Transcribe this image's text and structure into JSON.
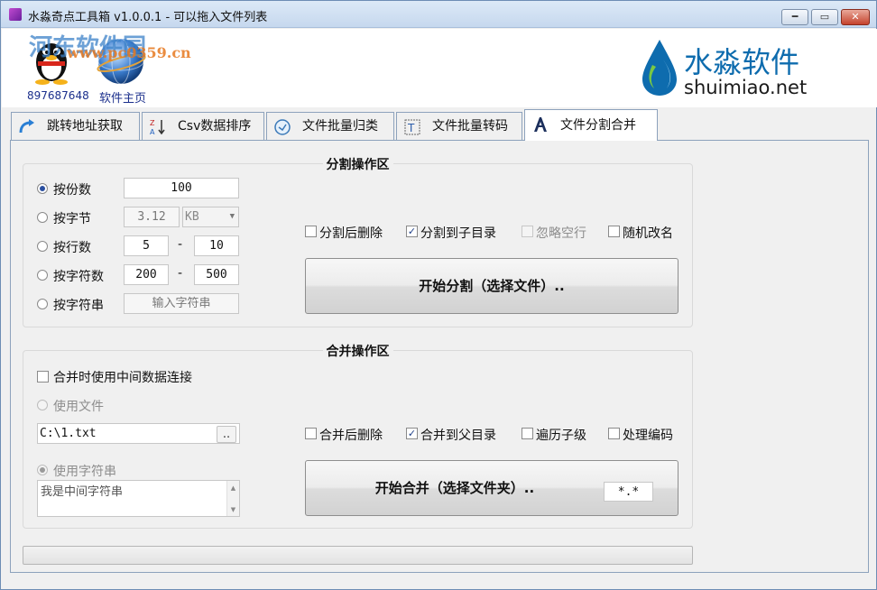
{
  "window": {
    "title": "水淼奇点工具箱 v1.0.0.1 - 可以拖入文件列表",
    "controls": {
      "minimize": "━",
      "maximize": "▭",
      "close": "✕"
    }
  },
  "header": {
    "watermark_cn": "河东软件园",
    "watermark_url": "www.pc0359.cn",
    "qq_number": "897687648",
    "homepage_label": "软件主页",
    "brand_cn": "水淼软件",
    "brand_en": "shuimiao.net",
    "brand_color": "#0e6cae"
  },
  "tabs": [
    {
      "label": "跳转地址获取",
      "icon": "redirect-arrow-icon"
    },
    {
      "label": "Csv数据排序",
      "icon": "sort-az-icon"
    },
    {
      "label": "文件批量归类",
      "icon": "classify-icon"
    },
    {
      "label": "文件批量转码",
      "icon": "transcode-icon"
    },
    {
      "label": "文件分割合并",
      "icon": "split-merge-icon",
      "active": true
    }
  ],
  "split": {
    "title": "分割操作区",
    "modes": {
      "by_count": {
        "label": "按份数",
        "value": "100",
        "selected": true
      },
      "by_bytes": {
        "label": "按字节",
        "value": "3.12",
        "unit": "KB"
      },
      "by_lines": {
        "label": "按行数",
        "from": "5",
        "to": "10"
      },
      "by_chars": {
        "label": "按字符数",
        "from": "200",
        "to": "500"
      },
      "by_string": {
        "label": "按字符串",
        "placeholder": "输入字符串"
      }
    },
    "dash": "-",
    "options": {
      "delete_after": {
        "label": "分割后删除",
        "checked": false
      },
      "to_subdir": {
        "label": "分割到子目录",
        "checked": true
      },
      "ignore_blank": {
        "label": "忽略空行",
        "checked": false,
        "disabled": true
      },
      "random_rename": {
        "label": "随机改名",
        "checked": false
      }
    },
    "start_button": "开始分割（选择文件）.."
  },
  "merge": {
    "title": "合并操作区",
    "use_middle": {
      "label": "合并时使用中间数据连接",
      "checked": false
    },
    "use_file": {
      "label": "使用文件",
      "path": "C:\\1.txt",
      "browse": ".."
    },
    "use_string": {
      "label": "使用字符串",
      "text": "我是中间字符串",
      "selected": true
    },
    "options": {
      "delete_after": {
        "label": "合并后删除",
        "checked": false
      },
      "to_parent": {
        "label": "合并到父目录",
        "checked": true
      },
      "traverse_sub": {
        "label": "遍历子级",
        "checked": false
      },
      "handle_encoding": {
        "label": "处理编码",
        "checked": false
      }
    },
    "start_button": "开始合并（选择文件夹）..",
    "filter": "*.*"
  },
  "progress": {
    "value": 0
  },
  "check_mark": "✓"
}
